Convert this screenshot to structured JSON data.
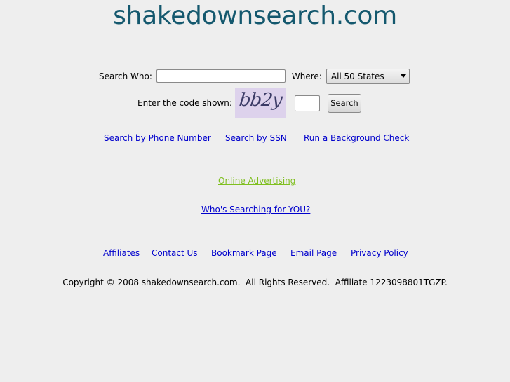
{
  "site": {
    "title": "shakedownsearch.com"
  },
  "search": {
    "who_label": "Search Who:",
    "who_value": "",
    "where_label": "Where:",
    "where_selected": "All 50 States",
    "code_label": "Enter the code shown:",
    "captcha_text": "bb2y",
    "code_value": "",
    "submit_label": "Search"
  },
  "search_links": [
    "Search by Phone Number",
    "Search by SSN",
    "Run a Background Check"
  ],
  "promo": {
    "advertising": "Online Advertising",
    "whos_searching": "Who's Searching for YOU?"
  },
  "footer_links": [
    "Affiliates",
    "Contact Us",
    "Bookmark Page",
    "Email Page",
    "Privacy Policy"
  ],
  "copyright": "Copyright © 2008 shakedownsearch.com.  All Rights Reserved.  Affiliate 1223098801TGZP.",
  "colors": {
    "title": "#14586e",
    "link": "#0000cc",
    "promo_link": "#7fbf1f",
    "captcha_bg": "#ddd2ec",
    "page_bg": "#eeeeee"
  }
}
